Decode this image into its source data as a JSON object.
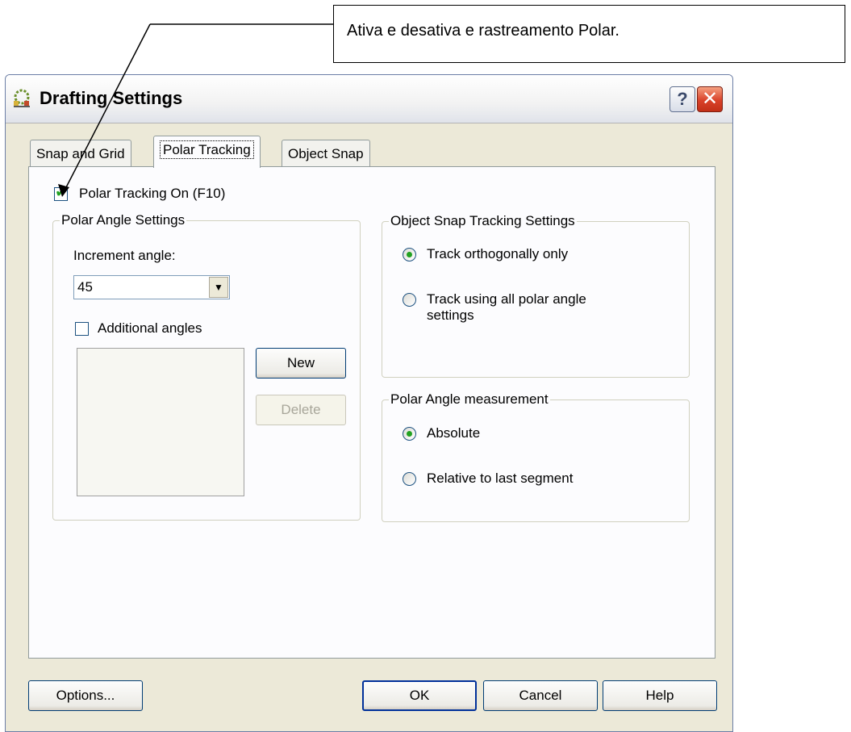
{
  "callout": {
    "text": "Ativa e desativa e rastreamento Polar."
  },
  "window": {
    "title": "Drafting Settings",
    "app_icon": "autocad-drafting-icon",
    "help_glyph": "?",
    "close_glyph": "✕"
  },
  "tabs": [
    {
      "label": "Snap and Grid"
    },
    {
      "label": "Polar Tracking",
      "active": true
    },
    {
      "label": "Object Snap"
    }
  ],
  "polar_on": {
    "label": "Polar Tracking On (F10)",
    "checked": true
  },
  "polar_angle_group": {
    "title": "Polar Angle Settings",
    "increment_label": "Increment angle:",
    "increment_value": "45",
    "additional_label": "Additional angles",
    "additional_checked": false,
    "new_label": "New",
    "delete_label": "Delete"
  },
  "tracking_group": {
    "title": "Object Snap Tracking Settings",
    "option1": "Track orthogonally only",
    "option2_line1": "Track using all polar angle",
    "option2_line2": "settings",
    "selected": 1
  },
  "measurement_group": {
    "title": "Polar Angle measurement",
    "option1": "Absolute",
    "option2": "Relative to last segment",
    "selected": 1
  },
  "footer": {
    "options_label": "Options...",
    "ok_label": "OK",
    "cancel_label": "Cancel",
    "help_label": "Help"
  }
}
